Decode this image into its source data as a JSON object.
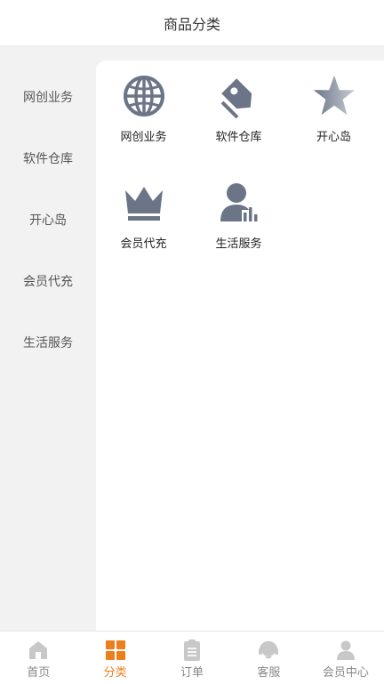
{
  "header": {
    "title": "商品分类"
  },
  "sidebar": {
    "items": [
      {
        "label": "网创业务"
      },
      {
        "label": "软件仓库"
      },
      {
        "label": "开心岛"
      },
      {
        "label": "会员代充"
      },
      {
        "label": "生活服务"
      }
    ]
  },
  "categories": [
    {
      "label": "网创业务",
      "icon": "globe-icon"
    },
    {
      "label": "软件仓库",
      "icon": "tag-icon"
    },
    {
      "label": "开心岛",
      "icon": "star-icon"
    },
    {
      "label": "会员代充",
      "icon": "crown-icon"
    },
    {
      "label": "生活服务",
      "icon": "user-chart-icon"
    }
  ],
  "tabbar": {
    "items": [
      {
        "label": "首页",
        "icon": "home-icon"
      },
      {
        "label": "分类",
        "icon": "category-icon",
        "active": true
      },
      {
        "label": "订单",
        "icon": "order-icon"
      },
      {
        "label": "客服",
        "icon": "support-icon"
      },
      {
        "label": "会员中心",
        "icon": "user-icon"
      }
    ]
  },
  "colors": {
    "accent": "#ee7d1b",
    "icon_gray": "#6b7587",
    "tab_gray": "#c8c8c8"
  }
}
